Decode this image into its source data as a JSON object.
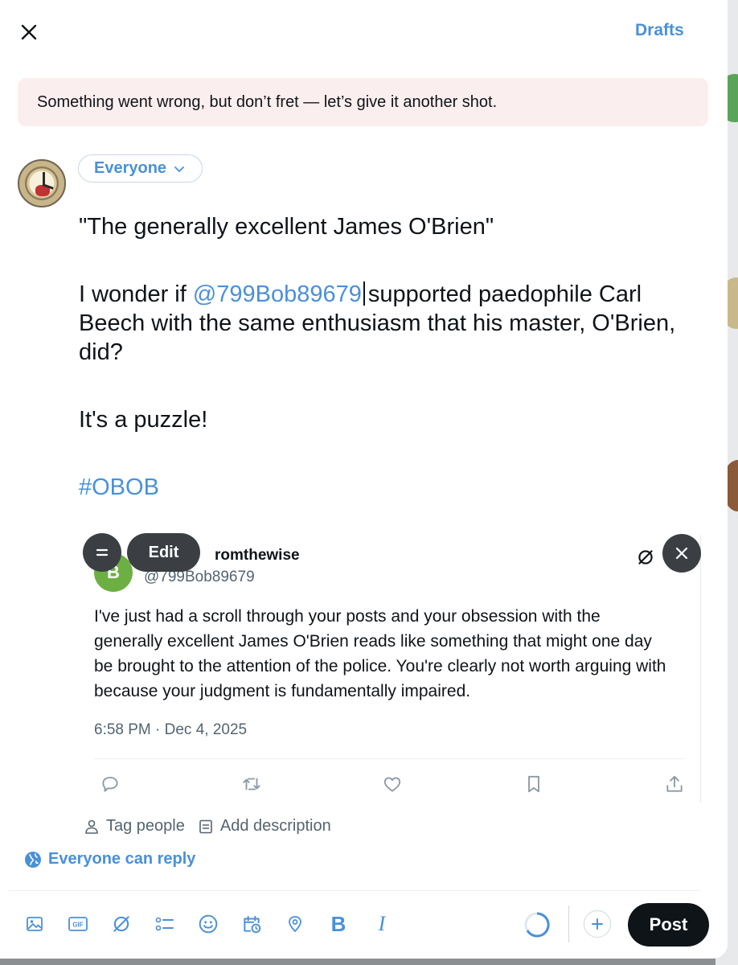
{
  "header": {
    "drafts_label": "Drafts"
  },
  "error_banner": {
    "message": "Something went wrong, but don’t fret — let’s give it another shot."
  },
  "audience": {
    "label": "Everyone"
  },
  "composer": {
    "line1": "\"The generally excellent James O'Brien\"",
    "line2_prefix": "I wonder if ",
    "mention": "@799Bob89679",
    "line2_suffix": "supported paedophile Carl Beech with the same enthusiasm that his master, O'Brien, did?",
    "line3": "It's a puzzle!",
    "hashtag": "#OBOB"
  },
  "quote": {
    "avatar_letter": "B",
    "name_visible": "romthewise",
    "handle": "@799Bob89679",
    "text": "I've just had a scroll through your posts and your obsession with the generally excellent James O'Brien reads like something that might one day be brought to the attention of the police. You're clearly not worth arguing with because your judgment is fundamentally impaired.",
    "timestamp": "6:58 PM · Dec 4, 2025",
    "edit_label": "Edit"
  },
  "media_actions": {
    "tag_people": "Tag people",
    "add_description": "Add description"
  },
  "reply_setting": {
    "label": "Everyone can reply"
  },
  "toolbar": {
    "gif_label": "GIF",
    "bold_label": "B",
    "italic_label": "I",
    "post_label": "Post"
  },
  "colors": {
    "accent": "#4a90d9",
    "post_button": "#0f1419",
    "error_bg": "#fbeeee"
  }
}
